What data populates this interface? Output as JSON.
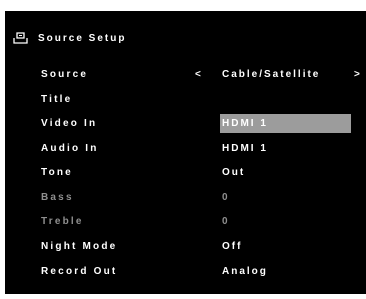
{
  "header": {
    "title": "Source Setup",
    "icon": "source-icon"
  },
  "selector": {
    "left_arrow": "<",
    "right_arrow": ">"
  },
  "rows": [
    {
      "label": "Source",
      "value": "Cable/Satellite",
      "state": "normal"
    },
    {
      "label": "Title",
      "value": "",
      "state": "normal"
    },
    {
      "label": "Video In",
      "value": "HDMI 1",
      "state": "selected"
    },
    {
      "label": "Audio In",
      "value": "HDMI 1",
      "state": "normal"
    },
    {
      "label": "Tone",
      "value": "Out",
      "state": "normal"
    },
    {
      "label": "Bass",
      "value": "0",
      "state": "disabled"
    },
    {
      "label": "Treble",
      "value": "0",
      "state": "disabled"
    },
    {
      "label": "Night Mode",
      "value": "Off",
      "state": "normal"
    },
    {
      "label": "Record Out",
      "value": "Analog",
      "state": "normal"
    }
  ],
  "colors": {
    "background": "#000000",
    "text": "#ffffff",
    "disabled_text": "#8f8f8f",
    "highlight": "#9c9c9c"
  }
}
